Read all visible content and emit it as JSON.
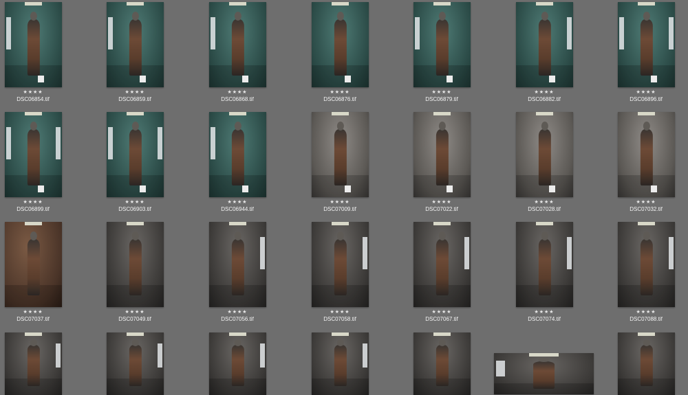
{
  "browser": {
    "rating_glyph": "★★★★",
    "thumbnails": [
      {
        "filename": "DSC06854.tif",
        "rating": 4,
        "tone": "teal",
        "lights": "left"
      },
      {
        "filename": "DSC06859.tif",
        "rating": 4,
        "tone": "teal",
        "lights": "left"
      },
      {
        "filename": "DSC06868.tif",
        "rating": 4,
        "tone": "teal",
        "lights": "left"
      },
      {
        "filename": "DSC06876.tif",
        "rating": 4,
        "tone": "teal",
        "lights": "none"
      },
      {
        "filename": "DSC06879.tif",
        "rating": 4,
        "tone": "teal",
        "lights": "left"
      },
      {
        "filename": "DSC06882.tif",
        "rating": 4,
        "tone": "teal",
        "lights": "right"
      },
      {
        "filename": "DSC06896.tif",
        "rating": 4,
        "tone": "teal",
        "lights": "both"
      },
      {
        "filename": "DSC06899.tif",
        "rating": 4,
        "tone": "teal",
        "lights": "both"
      },
      {
        "filename": "DSC06903.tif",
        "rating": 4,
        "tone": "teal",
        "lights": "both"
      },
      {
        "filename": "DSC06944.tif",
        "rating": 4,
        "tone": "teal",
        "lights": "left"
      },
      {
        "filename": "DSC07009.tif",
        "rating": 4,
        "tone": "grey",
        "lights": "none"
      },
      {
        "filename": "DSC07022.tif",
        "rating": 4,
        "tone": "grey",
        "lights": "none"
      },
      {
        "filename": "DSC07028.tif",
        "rating": 4,
        "tone": "grey",
        "lights": "none"
      },
      {
        "filename": "DSC07032.tif",
        "rating": 4,
        "tone": "grey",
        "lights": "none"
      },
      {
        "filename": "DSC07037.tif",
        "rating": 4,
        "tone": "brown",
        "lights": "none"
      },
      {
        "filename": "DSC07049.tif",
        "rating": 4,
        "tone": "dark",
        "lights": "none"
      },
      {
        "filename": "DSC07056.tif",
        "rating": 4,
        "tone": "dark",
        "lights": "right"
      },
      {
        "filename": "DSC07058.tif",
        "rating": 4,
        "tone": "dark",
        "lights": "right"
      },
      {
        "filename": "DSC07067.tif",
        "rating": 4,
        "tone": "dark",
        "lights": "right"
      },
      {
        "filename": "DSC07074.tif",
        "rating": 4,
        "tone": "dark",
        "lights": "right"
      },
      {
        "filename": "DSC07088.tif",
        "rating": 4,
        "tone": "dark",
        "lights": "right"
      },
      {
        "filename": "",
        "rating": 0,
        "tone": "dark",
        "lights": "right"
      },
      {
        "filename": "",
        "rating": 0,
        "tone": "dark",
        "lights": "right"
      },
      {
        "filename": "",
        "rating": 0,
        "tone": "dark",
        "lights": "right"
      },
      {
        "filename": "",
        "rating": 0,
        "tone": "dark",
        "lights": "right"
      },
      {
        "filename": "",
        "rating": 0,
        "tone": "dark",
        "lights": "none"
      },
      {
        "filename": "",
        "rating": 0,
        "tone": "dark",
        "lights": "left"
      },
      {
        "filename": "",
        "rating": 0,
        "tone": "dark",
        "lights": "none"
      }
    ]
  }
}
